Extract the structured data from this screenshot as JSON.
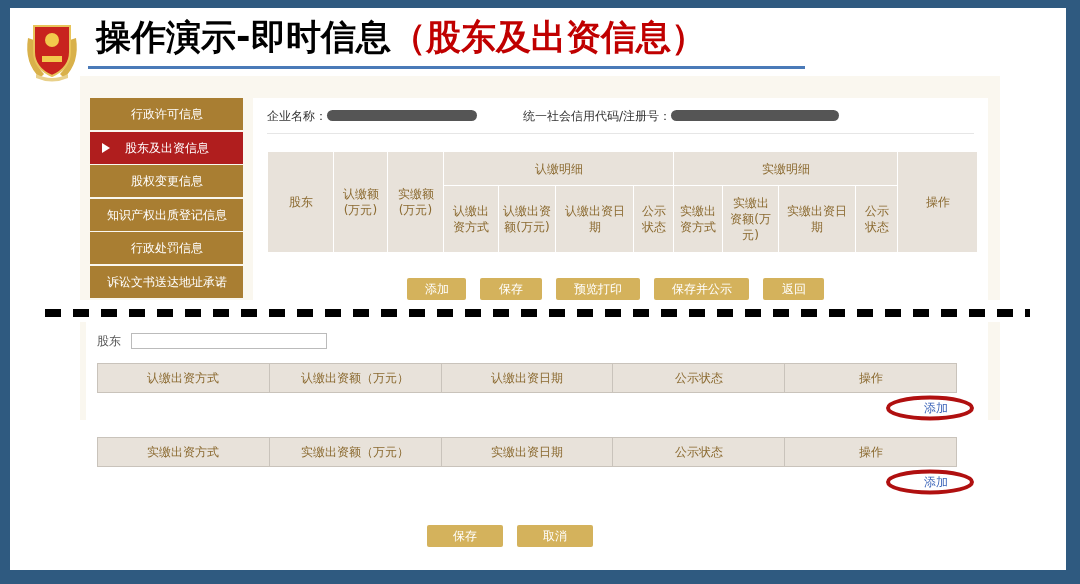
{
  "slide": {
    "title": "操作演示-即时信息",
    "title_highlight": "（股东及出资信息）"
  },
  "sidebar": {
    "items": [
      {
        "label": "行政许可信息",
        "selected": false
      },
      {
        "label": "股东及出资信息",
        "selected": true
      },
      {
        "label": "股权变更信息",
        "selected": false
      },
      {
        "label": "知识产权出质登记信息",
        "selected": false
      },
      {
        "label": "行政处罚信息",
        "selected": false
      },
      {
        "label": "诉讼文书送达地址承诺",
        "selected": false
      }
    ]
  },
  "info_fields": [
    {
      "label": "企业名称："
    },
    {
      "label": "统一社会信用代码/注册号："
    }
  ],
  "summary_table": {
    "columns": [
      {
        "label": "股东"
      },
      {
        "label": "认缴额(万元)"
      },
      {
        "label": "实缴额(万元)"
      },
      {
        "label": "认缴明细",
        "children": [
          {
            "label": "认缴出资方式"
          },
          {
            "label": "认缴出资额(万元)"
          },
          {
            "label": "认缴出资日期"
          },
          {
            "label": "公示状态"
          }
        ]
      },
      {
        "label": "实缴明细",
        "children": [
          {
            "label": "实缴出资方式"
          },
          {
            "label": "实缴出资额(万元)"
          },
          {
            "label": "实缴出资日期"
          },
          {
            "label": "公示状态"
          }
        ]
      },
      {
        "label": "操作"
      }
    ]
  },
  "toolbar_buttons": [
    "添加",
    "保存",
    "预览打印",
    "保存并公示",
    "返回"
  ],
  "form": {
    "shareholder_label": "股东",
    "tables": [
      {
        "columns": [
          "认缴出资方式",
          "认缴出资额（万元）",
          "认缴出资日期",
          "公示状态",
          "操作"
        ],
        "add_link": "添加",
        "circled": true
      },
      {
        "columns": [
          "实缴出资方式",
          "实缴出资额（万元）",
          "实缴出资日期",
          "公示状态",
          "操作"
        ],
        "add_link": "添加",
        "circled": true
      }
    ],
    "buttons": [
      "保存",
      "取消"
    ]
  }
}
